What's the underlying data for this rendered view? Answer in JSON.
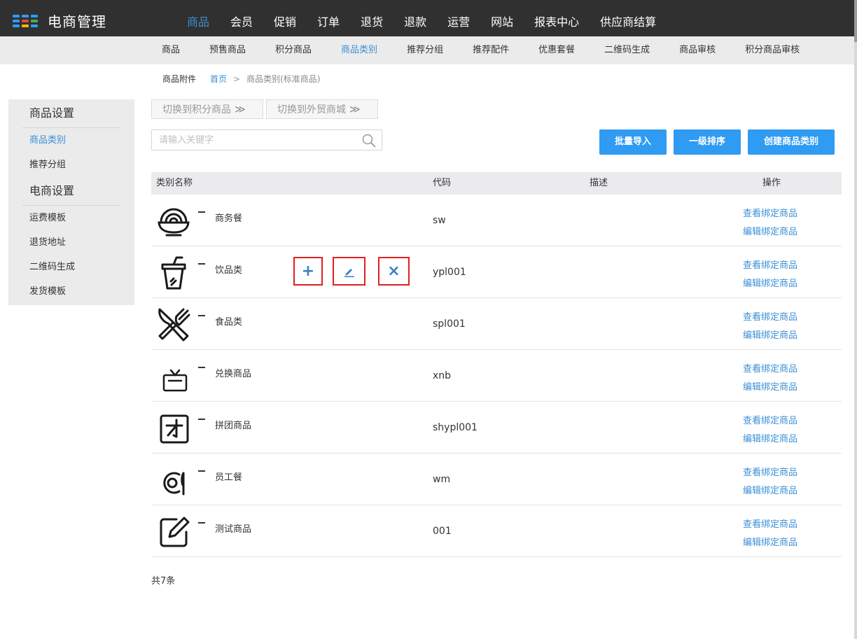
{
  "app": {
    "title": "电商管理"
  },
  "top_nav": [
    "商品",
    "会员",
    "促销",
    "订单",
    "退货",
    "退款",
    "运营",
    "网站",
    "报表中心",
    "供应商结算"
  ],
  "sub_nav": [
    "商品",
    "预售商品",
    "积分商品",
    "商品类别",
    "推荐分组",
    "推荐配件",
    "优惠套餐",
    "二维码生成",
    "商品审核",
    "积分商品审核"
  ],
  "breadcrumb": {
    "section": "商品附件",
    "home": "首页",
    "separator": ">",
    "current": "商品类别(标准商品)"
  },
  "sidebar": {
    "group1": "商品设置",
    "group1_items": [
      "商品类别",
      "推荐分组"
    ],
    "group2": "电商设置",
    "group2_items": [
      "运费模板",
      "退货地址",
      "二维码生成",
      "发货模板"
    ]
  },
  "switch_buttons": {
    "points": "切换到积分商品",
    "foreign": "切换到外贸商城",
    "arrow": "≫"
  },
  "search": {
    "placeholder": "请输入关键字",
    "value": ""
  },
  "actions": {
    "import": "批量导入",
    "sort": "一级排序",
    "create": "创建商品类别"
  },
  "table": {
    "headers": {
      "name": "类别名称",
      "code": "代码",
      "desc": "描述",
      "ops": "操作"
    },
    "rows": [
      {
        "name": "商务餐",
        "code": "sw",
        "desc": "",
        "icon": "noodle-bowl-icon",
        "op1": "查看绑定商品",
        "op2": "编辑绑定商品"
      },
      {
        "name": "饮品类",
        "code": "ypl001",
        "desc": "",
        "icon": "drink-cup-icon",
        "op1": "查看绑定商品",
        "op2": "编辑绑定商品"
      },
      {
        "name": "食品类",
        "code": "spl001",
        "desc": "",
        "icon": "fork-knife-icon",
        "op1": "查看绑定商品",
        "op2": "编辑绑定商品"
      },
      {
        "name": "兑换商品",
        "code": "xnb",
        "desc": "",
        "icon": "gift-box-icon",
        "op1": "查看绑定商品",
        "op2": "编辑绑定商品"
      },
      {
        "name": "拼团商品",
        "code": "shypl001",
        "desc": "",
        "icon": "group-buy-icon",
        "op1": "查看绑定商品",
        "op2": "编辑绑定商品"
      },
      {
        "name": "员工餐",
        "code": "wm",
        "desc": "",
        "icon": "plate-fork-icon",
        "op1": "查看绑定商品",
        "op2": "编辑绑定商品"
      },
      {
        "name": "测试商品",
        "code": "001",
        "desc": "",
        "icon": "edit-note-icon",
        "op1": "查看绑定商品",
        "op2": "编辑绑定商品"
      }
    ]
  },
  "row_actions": {
    "add": "+",
    "edit": "pencil-icon",
    "delete": "×"
  },
  "footer": {
    "total": "共7条"
  },
  "colors": {
    "topbar": "#303030",
    "accent": "#3b8fd6",
    "button": "#2f9bf3",
    "highlight_border": "#e02020"
  }
}
